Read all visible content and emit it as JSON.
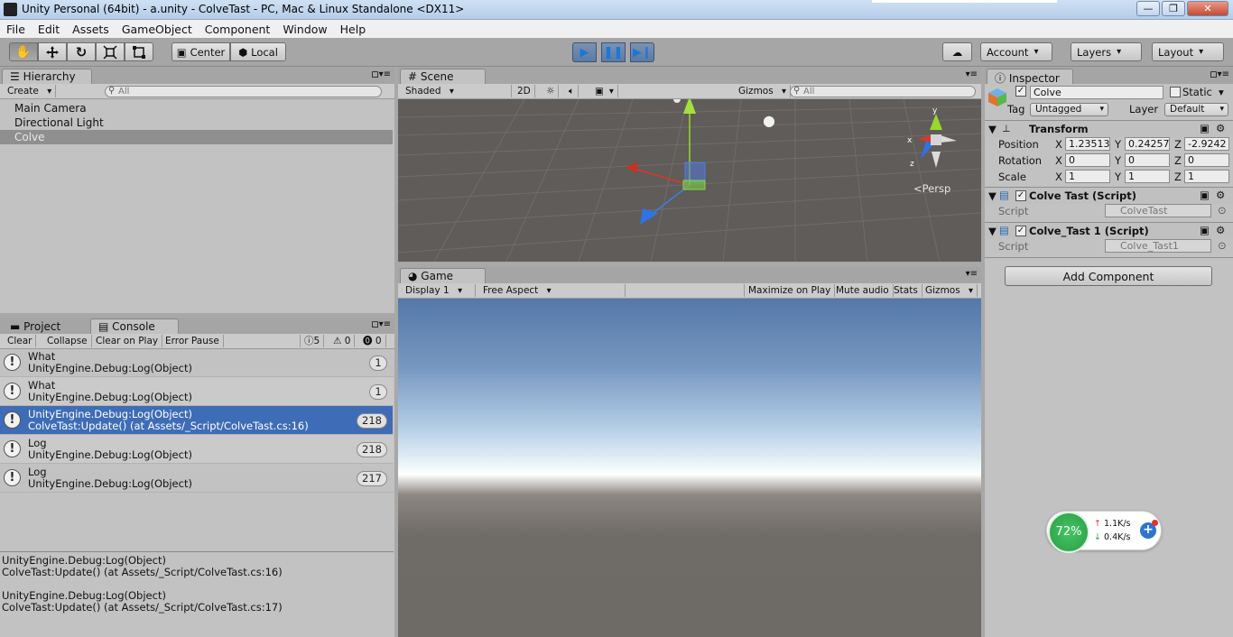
{
  "window": {
    "title": "Unity Personal (64bit) - a.unity - ColveTast - PC, Mac & Linux Standalone <DX11>",
    "controls": [
      "—",
      "❐",
      "✕"
    ]
  },
  "menu": [
    "File",
    "Edit",
    "Assets",
    "GameObject",
    "Component",
    "Window",
    "Help"
  ],
  "toolbar": {
    "pivot": "Center",
    "space": "Local",
    "account": "Account",
    "layers": "Layers",
    "layout": "Layout"
  },
  "hierarchy": {
    "tab": "Hierarchy",
    "create": "Create",
    "search_placeholder": "All",
    "items": [
      "Main Camera",
      "Directional Light",
      "Colve"
    ]
  },
  "scene": {
    "tab": "Scene",
    "shading": "Shaded",
    "mode2d": "2D",
    "gizmos": "Gizmos",
    "search_placeholder": "All",
    "persp": "Persp",
    "axis_x": "x",
    "axis_y": "y",
    "axis_z": "z"
  },
  "game": {
    "tab": "Game",
    "display": "Display 1",
    "aspect": "Free Aspect",
    "maximize": "Maximize on Play",
    "mute": "Mute audio",
    "stats": "Stats",
    "gizmos": "Gizmos"
  },
  "console": {
    "tab_project": "Project",
    "tab_console": "Console",
    "clear": "Clear",
    "collapse": "Collapse",
    "clear_on_play": "Clear on Play",
    "error_pause": "Error Pause",
    "log_count": "5",
    "warn_count": "0",
    "error_count": "0",
    "entries": [
      {
        "line1": "What",
        "line2": "UnityEngine.Debug:Log(Object)",
        "count": "1"
      },
      {
        "line1": "What",
        "line2": "UnityEngine.Debug:Log(Object)",
        "count": "1"
      },
      {
        "line1": "UnityEngine.Debug:Log(Object)",
        "line2": "ColveTast:Update() (at Assets/_Script/ColveTast.cs:16)",
        "count": "218"
      },
      {
        "line1": "Log",
        "line2": "UnityEngine.Debug:Log(Object)",
        "count": "218"
      },
      {
        "line1": "Log",
        "line2": "UnityEngine.Debug:Log(Object)",
        "count": "217"
      }
    ],
    "detail": [
      "UnityEngine.Debug:Log(Object)",
      "ColveTast:Update() (at Assets/_Script/ColveTast.cs:16)",
      "UnityEngine.Debug:Log(Object)",
      "ColveTast:Update() (at Assets/_Script/ColveTast.cs:17)"
    ]
  },
  "inspector": {
    "tab": "Inspector",
    "object_name": "Colve",
    "static_label": "Static",
    "tag_label": "Tag",
    "tag_value": "Untagged",
    "layer_label": "Layer",
    "layer_value": "Default",
    "transform": {
      "title": "Transform",
      "position_label": "Position",
      "rotation_label": "Rotation",
      "scale_label": "Scale",
      "position": {
        "x": "1.23513",
        "y": "0.24257",
        "z": "-2.9242"
      },
      "rotation": {
        "x": "0",
        "y": "0",
        "z": "0"
      },
      "scale": {
        "x": "1",
        "y": "1",
        "z": "1"
      }
    },
    "components": [
      {
        "title": "Colve Tast (Script)",
        "script_label": "Script",
        "script_value": "ColveTast"
      },
      {
        "title": "Colve_Tast 1 (Script)",
        "script_label": "Script",
        "script_value": "Colve_Tast1"
      }
    ],
    "add_component": "Add Component"
  },
  "network": {
    "percent": "72%",
    "up": "1.1K/s",
    "down": "0.4K/s"
  }
}
